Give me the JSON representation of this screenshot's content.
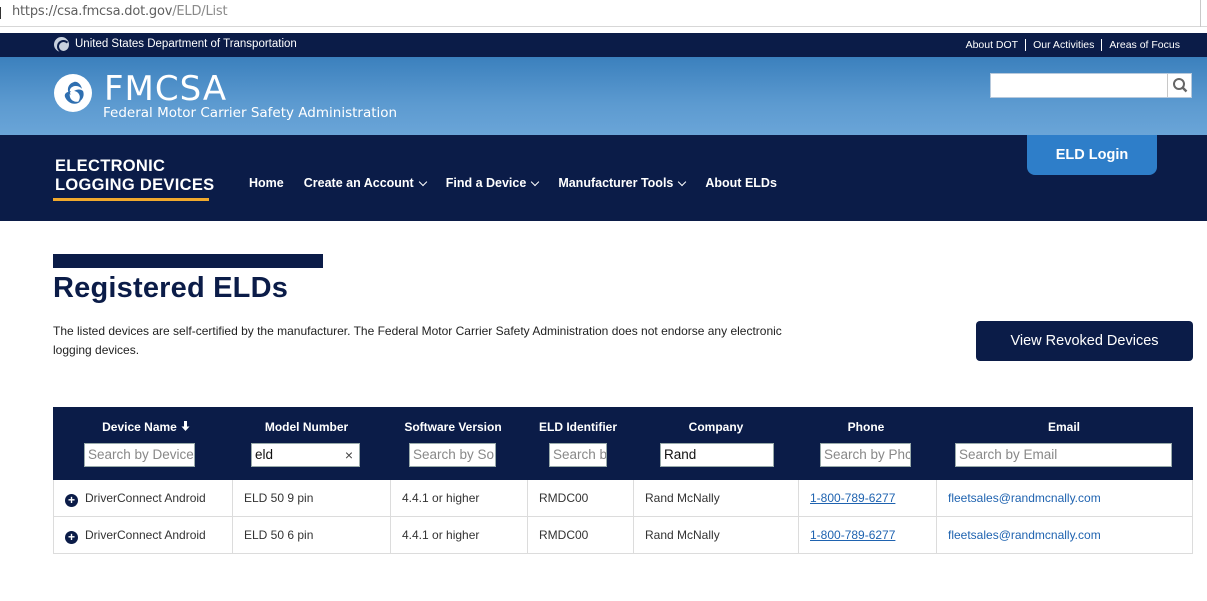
{
  "browser": {
    "url_host": "https://csa.fmcsa.dot.gov",
    "url_path": "/ELD/List"
  },
  "dot_bar": {
    "department": "United States Department of Transportation",
    "links": [
      "About DOT",
      "Our Activities",
      "Areas of Focus"
    ]
  },
  "banner": {
    "brand": "FMCSA",
    "subtitle": "Federal Motor Carrier Safety Administration",
    "search_value": ""
  },
  "nav": {
    "site_title_line1": "ELECTRONIC",
    "site_title_line2": "LOGGING DEVICES",
    "items": [
      {
        "label": "Home",
        "dropdown": false
      },
      {
        "label": "Create an Account",
        "dropdown": true
      },
      {
        "label": "Find a Device",
        "dropdown": true
      },
      {
        "label": "Manufacturer Tools",
        "dropdown": true
      },
      {
        "label": "About ELDs",
        "dropdown": false
      }
    ],
    "login_label": "ELD Login"
  },
  "page": {
    "title": "Registered ELDs",
    "disclaimer": "The listed devices are self-certified by the manufacturer. The Federal Motor Carrier Safety Administration does not endorse any electronic logging devices.",
    "revoked_button": "View Revoked Devices"
  },
  "table": {
    "columns": [
      {
        "label": "Device Name",
        "sort_icon": "arrow-down-icon",
        "filter_placeholder": "Search by Device",
        "filter_value": ""
      },
      {
        "label": "Model Number",
        "filter_placeholder": "",
        "filter_value": "eld"
      },
      {
        "label": "Software Version",
        "filter_placeholder": "Search by So",
        "filter_value": ""
      },
      {
        "label": "ELD Identifier",
        "filter_placeholder": "Search b",
        "filter_value": ""
      },
      {
        "label": "Company",
        "filter_placeholder": "",
        "filter_value": "Rand"
      },
      {
        "label": "Phone",
        "filter_placeholder": "Search by Phc",
        "filter_value": ""
      },
      {
        "label": "Email",
        "filter_placeholder": "Search by Email",
        "filter_value": ""
      }
    ],
    "rows": [
      [
        "DriverConnect Android",
        "ELD 50 9 pin",
        "4.4.1 or higher",
        "RMDC00",
        "Rand McNally",
        "1-800-789-6277",
        "fleetsales@randmcnally.com"
      ],
      [
        "DriverConnect Android",
        "ELD 50 6 pin",
        "4.4.1 or higher",
        "RMDC00",
        "Rand McNally",
        "1-800-789-6277",
        "fleetsales@randmcnally.com"
      ]
    ]
  },
  "colors": {
    "navy": "#0b1c48",
    "banner_blue": "#4a8dc8",
    "accent_orange": "#f0a92d",
    "login_blue": "#2e7ec9",
    "link_blue": "#1f63b0"
  }
}
